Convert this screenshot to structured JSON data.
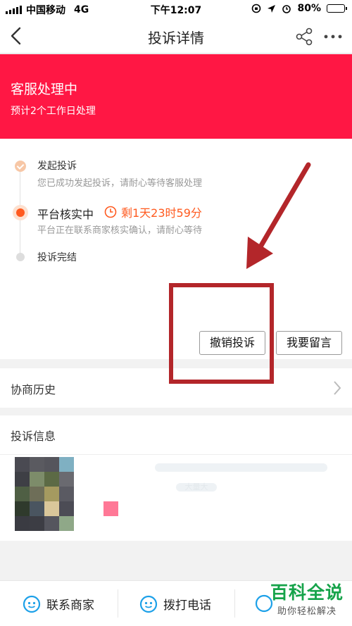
{
  "status_bar": {
    "carrier": "中国移动",
    "network": "4G",
    "time": "下午12:07",
    "battery": "80%",
    "battery_level": 0.8
  },
  "nav": {
    "title": "投诉详情"
  },
  "banner": {
    "title": "客服处理中",
    "subtitle": "预计2个工作日处理",
    "color": "#ff1744"
  },
  "progress": {
    "steps": [
      {
        "title": "发起投诉",
        "desc": "您已成功发起投诉，请耐心等待客服处理",
        "state": "done"
      },
      {
        "title": "平台核实中",
        "desc": "平台正在联系商家核实确认，请耐心等待",
        "state": "active"
      },
      {
        "title": "投诉完结",
        "desc": "",
        "state": "pending"
      }
    ],
    "countdown": "剩1天23时59分",
    "accent": "#ff5a1f"
  },
  "actions": {
    "revoke_label": "撤销投诉",
    "message_label": "我要留言"
  },
  "history": {
    "label": "协商历史"
  },
  "complaint_info": {
    "title": "投诉信息",
    "product_text_line2": "大量大"
  },
  "bottom_bar": {
    "contact_merchant": "联系商家",
    "call_phone": "拨打电话"
  },
  "watermark": {
    "main": "百科全说",
    "sub": "助你轻松解决"
  }
}
